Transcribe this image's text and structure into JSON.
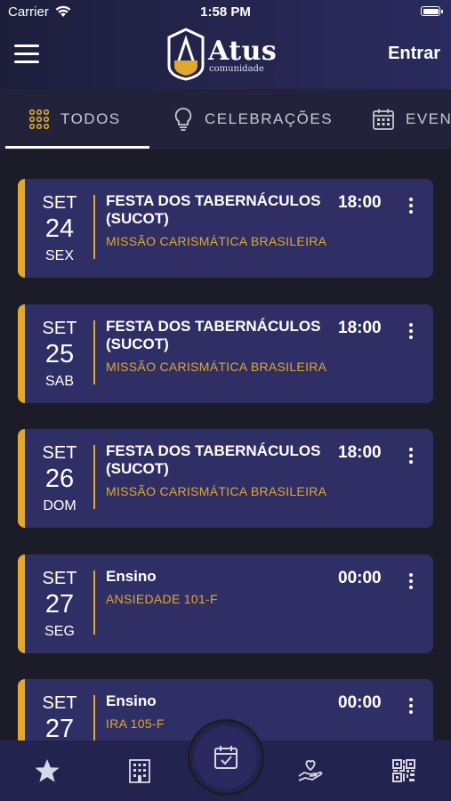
{
  "status_bar": {
    "carrier": "Carrier",
    "time": "1:58 PM"
  },
  "header": {
    "logo_title": "Atus",
    "logo_subtitle": "comunidade",
    "login_label": "Entrar"
  },
  "tabs": [
    {
      "label": "TODOS",
      "icon": "grid-dots-icon",
      "active": true
    },
    {
      "label": "CELEBRAÇÕES",
      "icon": "lightbulb-icon",
      "active": false
    },
    {
      "label": "EVEN",
      "icon": "calendar-icon",
      "active": false
    }
  ],
  "events": [
    {
      "month": "SET",
      "day": "24",
      "weekday": "SEX",
      "title": "FESTA DOS TABERNÁCULOS (SUCOT)",
      "subtitle": "MISSÃO CARISMÁTICA BRASILEIRA",
      "time": "18:00"
    },
    {
      "month": "SET",
      "day": "25",
      "weekday": "SAB",
      "title": "FESTA DOS TABERNÁCULOS (SUCOT)",
      "subtitle": "MISSÃO CARISMÁTICA BRASILEIRA",
      "time": "18:00"
    },
    {
      "month": "SET",
      "day": "26",
      "weekday": "DOM",
      "title": "FESTA DOS TABERNÁCULOS (SUCOT)",
      "subtitle": "MISSÃO CARISMÁTICA BRASILEIRA",
      "time": "18:00"
    },
    {
      "month": "SET",
      "day": "27",
      "weekday": "SEG",
      "title": "Ensino",
      "subtitle": "ANSIEDADE 101-F",
      "time": "00:00"
    },
    {
      "month": "SET",
      "day": "27",
      "weekday": "",
      "title": "Ensino",
      "subtitle": "IRA 105-F",
      "time": "00:00"
    }
  ],
  "bottom_nav": [
    {
      "icon": "star-icon"
    },
    {
      "icon": "building-icon"
    },
    {
      "icon": "calendar-check-icon",
      "active": true
    },
    {
      "icon": "hand-heart-icon"
    },
    {
      "icon": "qr-code-icon"
    }
  ],
  "colors": {
    "accent": "#e0a82f",
    "card": "#2f2f66",
    "header": "#2a2b5e",
    "background": "#1c1c28"
  }
}
